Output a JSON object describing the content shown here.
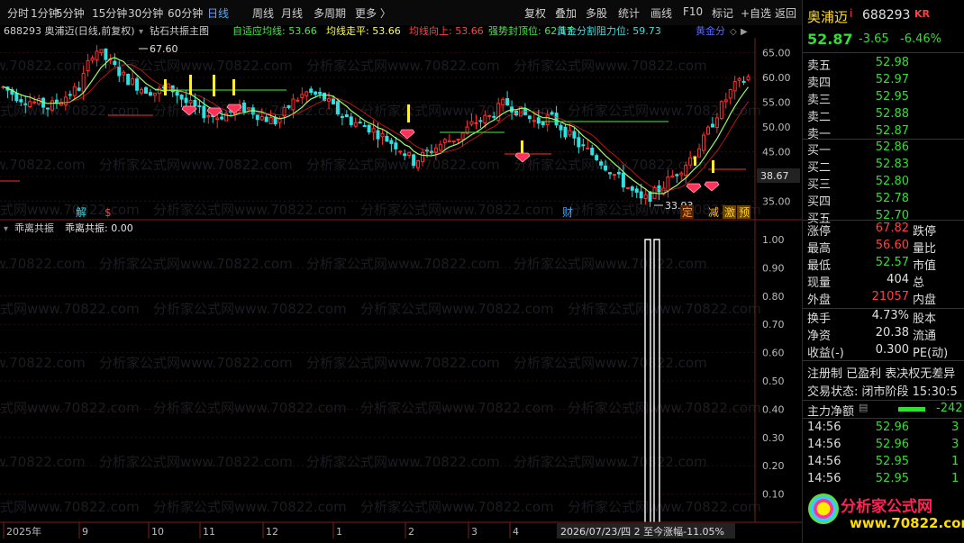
{
  "toolbar": {
    "left": [
      "分时",
      "1分钟",
      "5分钟",
      "15分钟",
      "30分钟",
      "60分钟",
      "日线",
      "周线",
      "月线",
      "多周期",
      "更多 〉"
    ],
    "right": [
      "复权",
      "叠加",
      "多股",
      "统计",
      "画线",
      "F10",
      "标记",
      "+自选",
      "返回"
    ],
    "active": "日线"
  },
  "main_header": {
    "stock": "688293 奥浦迈(日线,前复权)",
    "formula": "钻石共振主图",
    "items": [
      {
        "text": "自适应均线: 53.66",
        "color": "#44ee44"
      },
      {
        "text": "均线走平: 53.66",
        "color": "#ffff44"
      },
      {
        "text": "均线向上: 53.66",
        "color": "#ff4444"
      },
      {
        "text": "强势封顶位: 62.17",
        "color": "#44ee44"
      },
      {
        "text": "黄金分割阻力位: 59.73",
        "color": "#44dddd"
      },
      {
        "text": "黄金分",
        "color": "#5566ff"
      }
    ]
  },
  "chart_data": [
    {
      "type": "candlestick",
      "title": "688293 奥浦迈(日线,前复权)",
      "y_ticks": [
        "65.00",
        "60.00",
        "55.00",
        "50.00",
        "45.00",
        "40.00",
        "35.00"
      ],
      "ylim": [
        32,
        68
      ],
      "max_label": "67.60",
      "min_label": "33.93",
      "last_price_label": "38.67",
      "trend": [
        58,
        56,
        55,
        54,
        56,
        58,
        66,
        63,
        60,
        58,
        57,
        58,
        55,
        53,
        52,
        53,
        54,
        52,
        51,
        55,
        57,
        56,
        53,
        51,
        50,
        48,
        46,
        43,
        45,
        47,
        48,
        51,
        52,
        55,
        53,
        51,
        52,
        49,
        46,
        44,
        41,
        38,
        35,
        37,
        40,
        43,
        47,
        53,
        58,
        60
      ],
      "signal_labels": [
        "解",
        "$",
        "财",
        "定",
        "减",
        "激",
        "预"
      ]
    },
    {
      "type": "line",
      "title": "乖离共振",
      "series": [
        {
          "name": "乖离共振",
          "value_label": "0.00"
        }
      ],
      "y_ticks": [
        "1.00",
        "0.90",
        "0.80",
        "0.70",
        "0.60",
        "0.50",
        "0.40",
        "0.30",
        "0.20",
        "0.10"
      ],
      "ylim": [
        0,
        1
      ]
    }
  ],
  "sub_header": {
    "name": "乖离共振",
    "value": "乖离共振: 0.00"
  },
  "x_axis": {
    "labels": [
      "2025年",
      "9",
      "10",
      "11",
      "12",
      "1",
      "2",
      "3",
      "4"
    ],
    "cursor_text": "2026/07/23/四 2 至今涨幅-11.05%"
  },
  "quote": {
    "name": "奥浦迈",
    "code": "688293",
    "badge": "KR",
    "info": "i",
    "price": "52.87",
    "change": "-3.65",
    "pct": "-6.46%",
    "asks": [
      {
        "label": "卖五",
        "price": "52.98"
      },
      {
        "label": "卖四",
        "price": "52.97"
      },
      {
        "label": "卖三",
        "price": "52.95"
      },
      {
        "label": "卖二",
        "price": "52.88"
      },
      {
        "label": "卖一",
        "price": "52.87"
      }
    ],
    "bids": [
      {
        "label": "买一",
        "price": "52.86"
      },
      {
        "label": "买二",
        "price": "52.83"
      },
      {
        "label": "买三",
        "price": "52.80"
      },
      {
        "label": "买四",
        "price": "52.78"
      },
      {
        "label": "买五",
        "price": "52.70"
      }
    ],
    "stats": [
      {
        "label": "涨停",
        "value": "67.82",
        "cls": "red",
        "label2": "跌停"
      },
      {
        "label": "最高",
        "value": "56.60",
        "cls": "red",
        "label2": "量比"
      },
      {
        "label": "最低",
        "value": "52.57",
        "cls": "green",
        "label2": "市值"
      },
      {
        "label": "现量",
        "value": "404",
        "cls": "white",
        "label2": "总"
      },
      {
        "label": "外盘",
        "value": "21057",
        "cls": "red",
        "label2": "内盘"
      }
    ],
    "stats2": [
      {
        "label": "换手",
        "value": "4.73%",
        "label2": "股本"
      },
      {
        "label": "净资",
        "value": "20.38",
        "label2": "流通"
      },
      {
        "label": "收益(-)",
        "value": "0.300",
        "label2": "PE(动)"
      }
    ],
    "reg": "注册制 已盈利 表决权无差异",
    "status": "交易状态: 闭市阶段 15:30:5",
    "main_flow_label": "主力净额",
    "main_flow_value": "-242",
    "ticks": [
      {
        "time": "14:56",
        "price": "52.96",
        "vol": "3"
      },
      {
        "time": "14:56",
        "price": "52.96",
        "vol": "3"
      },
      {
        "time": "14:56",
        "price": "52.95",
        "vol": "1"
      },
      {
        "time": "14:56",
        "price": "52.95",
        "vol": "1"
      },
      {
        "time": "14:56",
        "price": "52.95",
        "vol": "1"
      }
    ]
  },
  "watermark": "分析家公式网www.70822.com",
  "logo": {
    "title": "分析家公式网",
    "url": "www.70822.com"
  }
}
